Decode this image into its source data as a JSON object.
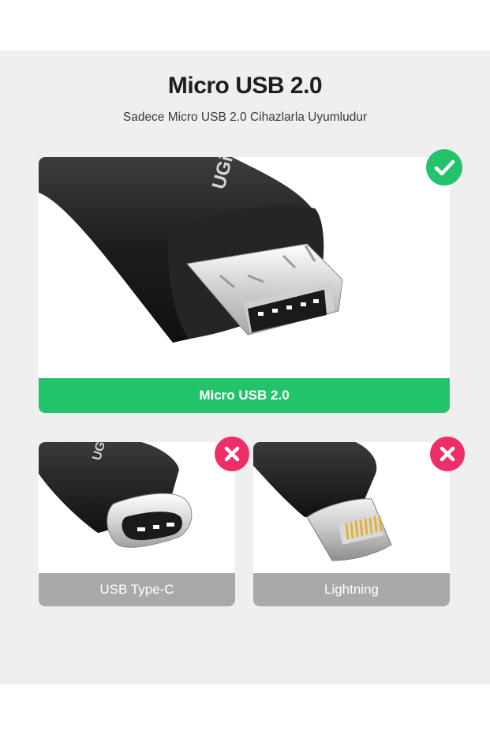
{
  "header": {
    "title": "Micro USB 2.0",
    "subtitle": "Sadece Micro USB 2.0 Cihazlarla Uyumludur"
  },
  "compatible": {
    "label": "Micro USB 2.0",
    "brand_text": "UGi",
    "status": "compatible",
    "icon": "check-icon",
    "color": "#23c36b"
  },
  "incompatible": [
    {
      "label": "USB Type-C",
      "brand_text": "UG",
      "status": "not-compatible",
      "icon": "close-icon",
      "color": "#ee2f67"
    },
    {
      "label": "Lightning",
      "status": "not-compatible",
      "icon": "close-icon",
      "color": "#ee2f67"
    }
  ],
  "colors": {
    "background": "#efefef",
    "success": "#23c36b",
    "error": "#ee2f67",
    "label_gray": "#a9a9a9"
  }
}
